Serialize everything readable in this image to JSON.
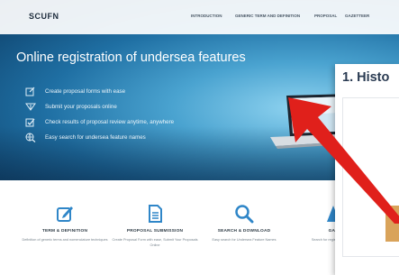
{
  "site": {
    "logo": "SCUFN",
    "nav": [
      "INTRODUCTION",
      "GENERIC TERM AND DEFINITION",
      "PROPOSAL",
      "GAZETTEER"
    ]
  },
  "hero": {
    "title": "Online registration of undersea features",
    "features": [
      {
        "icon": "edit-box-icon",
        "label": "Create proposal forms with ease"
      },
      {
        "icon": "submit-icon",
        "label": "Submit your proposals online"
      },
      {
        "icon": "checkbox-icon",
        "label": "Check results of proposal review anytime, anywhere"
      },
      {
        "icon": "globe-search-icon",
        "label": "Easy search for undersea feature names"
      }
    ]
  },
  "cards": [
    {
      "icon": "pencil-icon",
      "title": "TERM & DEFINITION",
      "desc": "Definition of generic terms and nomenclature techniques"
    },
    {
      "icon": "document-icon",
      "title": "PROPOSAL SUBMISSION",
      "desc": "Create Proposal Form with ease, Submit Your Proposals Online"
    },
    {
      "icon": "search-icon",
      "title": "SEARCH & DOWNLOAD",
      "desc": "Easy search for Undersea Feature Names"
    },
    {
      "icon": "gazetteer-icon",
      "title": "GAZ",
      "desc": "Search for registered feature"
    }
  ],
  "history_panel": {
    "title": "1. Histo"
  },
  "colors": {
    "accent_blue": "#2f86c8",
    "arrow_red": "#e0201b",
    "orange": "#d9a35a"
  }
}
